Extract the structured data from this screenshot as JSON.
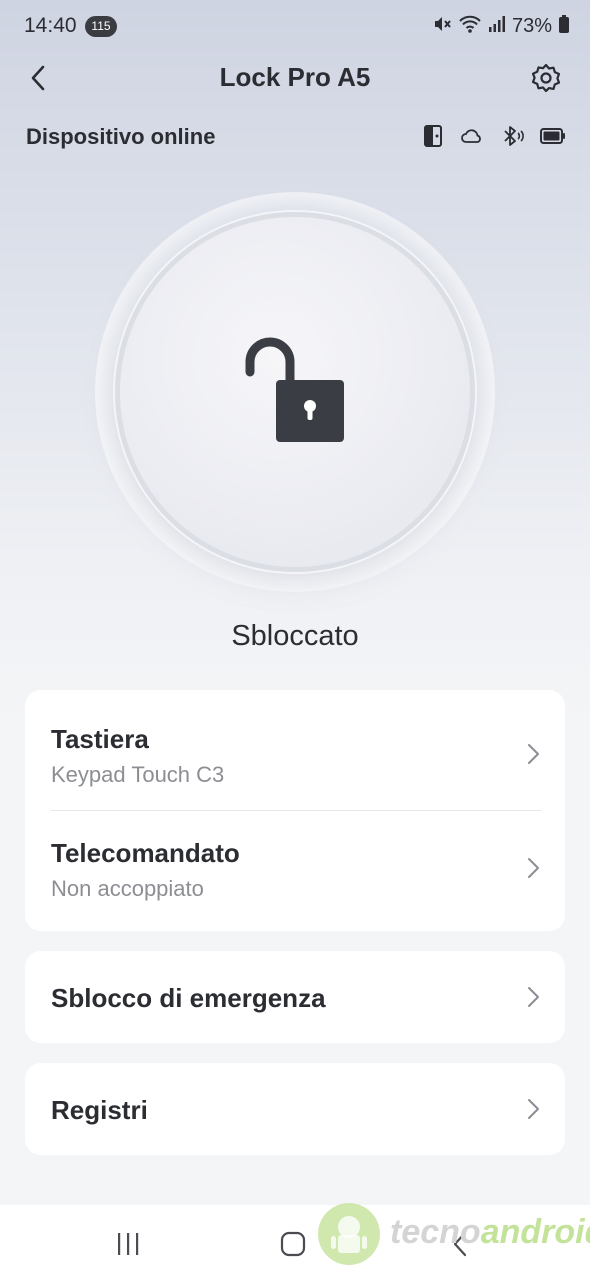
{
  "status_bar": {
    "time": "14:40",
    "badge": "115",
    "battery_text": "73%",
    "icons": [
      "mute-icon",
      "wifi-icon",
      "signal-icon",
      "battery-icon"
    ]
  },
  "header": {
    "title": "Lock Pro A5",
    "back_icon": "chevron-left-icon",
    "settings_icon": "gear-icon"
  },
  "device": {
    "status": "Dispositivo online",
    "icons": [
      "door-sensor-icon",
      "cloud-icon",
      "bluetooth-icon",
      "battery-icon"
    ]
  },
  "lock": {
    "state": "Sbloccato",
    "icon": "unlocked-padlock-icon"
  },
  "card_accessories": {
    "rows": [
      {
        "title": "Tastiera",
        "subtitle": "Keypad Touch C3"
      },
      {
        "title": "Telecomandato",
        "subtitle": "Non accoppiato"
      }
    ]
  },
  "card_emergency": {
    "title": "Sblocco di emergenza"
  },
  "card_logs": {
    "title": "Registri"
  },
  "nav": {
    "buttons": [
      "recent-apps",
      "home",
      "back"
    ]
  },
  "watermark": {
    "text_a": "tecno",
    "text_b": "android"
  },
  "colors": {
    "text": "#2b2d33",
    "subtext": "#8c8e94",
    "card": "#ffffff"
  }
}
